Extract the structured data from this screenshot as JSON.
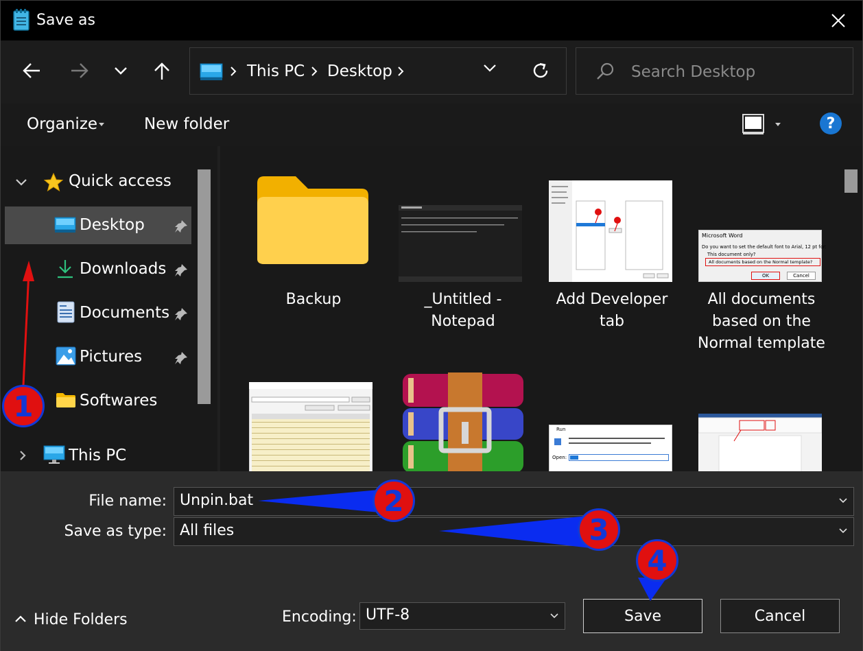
{
  "window": {
    "title": "Save as",
    "close_icon": "close-icon",
    "app_icon": "notepad-icon"
  },
  "nav": {
    "back_icon": "back-arrow-icon",
    "forward_icon": "forward-arrow-icon",
    "recent_icon": "chevron-down-icon",
    "up_icon": "up-arrow-icon",
    "breadcrumbs": [
      "This PC",
      "Desktop"
    ],
    "refresh_icon": "refresh-icon",
    "search_placeholder": "Search Desktop"
  },
  "toolbar": {
    "organize": "Organize",
    "new_folder": "New folder",
    "help": "?"
  },
  "sidebar": {
    "items": [
      {
        "label": "Quick access",
        "icon": "star-icon"
      },
      {
        "label": "Desktop",
        "icon": "desktop-icon",
        "pinned": true,
        "selected": true
      },
      {
        "label": "Downloads",
        "icon": "download-icon",
        "pinned": true
      },
      {
        "label": "Documents",
        "icon": "document-icon",
        "pinned": true
      },
      {
        "label": "Pictures",
        "icon": "pictures-icon",
        "pinned": true
      },
      {
        "label": "Softwares",
        "icon": "folder-icon"
      },
      {
        "label": "This PC",
        "icon": "monitor-icon"
      }
    ]
  },
  "files": [
    {
      "name": "Backup",
      "type": "folder"
    },
    {
      "name": "_Untitled - Notepad",
      "type": "image"
    },
    {
      "name": "Add Developer tab",
      "type": "image"
    },
    {
      "name": "All documents based on the Normal template",
      "type": "image"
    },
    {
      "name": "",
      "type": "image"
    },
    {
      "name": "",
      "type": "archive"
    },
    {
      "name": "",
      "type": "image"
    },
    {
      "name": "",
      "type": "image"
    }
  ],
  "thumbs": {
    "word_title": "Microsoft Word",
    "word_question": "Do you want to set the default font to Arial, 12 pt for:",
    "word_opt1": "This document only?",
    "word_opt2": "All documents based on the Normal template?",
    "word_ok": "OK",
    "word_cancel": "Cancel",
    "run_title": "Run",
    "run_open": "Open:"
  },
  "form": {
    "file_name_label": "File name:",
    "file_name_value": "Unpin.bat",
    "save_type_label": "Save as type:",
    "save_type_value": "All files",
    "encoding_label": "Encoding:",
    "encoding_value": "UTF-8",
    "hide_folders": "Hide Folders",
    "save": "Save",
    "cancel": "Cancel"
  },
  "annotations": [
    "1",
    "2",
    "3",
    "4"
  ],
  "colors": {
    "accent": "#1976d2",
    "badge_fill": "#e01010",
    "badge_text": "#1238d6",
    "arrow_blue": "#0a2cf0",
    "arrow_red": "#e01010"
  }
}
